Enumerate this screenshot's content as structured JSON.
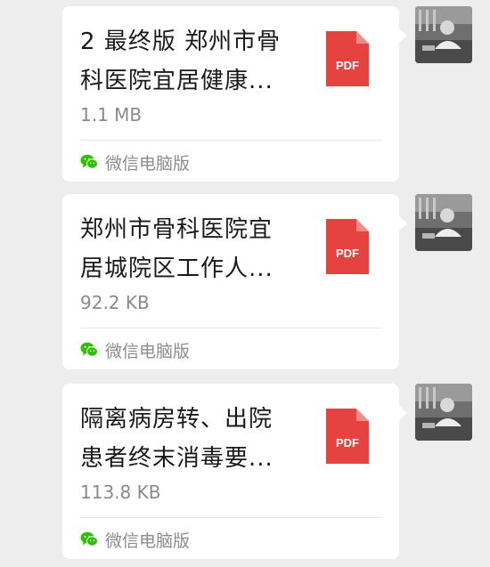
{
  "messages": [
    {
      "file_name_lines": [
        "2 最终版  郑州市骨",
        "科医院宜居健康..."
      ],
      "file_size": "1.1 MB",
      "file_type": "PDF",
      "source_label": "微信电脑版"
    },
    {
      "file_name_lines": [
        "郑州市骨科医院宜",
        "居城院区工作人..."
      ],
      "file_size": "92.2 KB",
      "file_type": "PDF",
      "source_label": "微信电脑版"
    },
    {
      "file_name_lines": [
        "隔离病房转、出院",
        "患者终末消毒要..."
      ],
      "file_size": "113.8 KB",
      "file_type": "PDF",
      "source_label": "微信电脑版"
    }
  ],
  "colors": {
    "background": "#ededed",
    "bubble": "#ffffff",
    "pdf_icon": "#e64340",
    "wechat_green": "#2dc100"
  },
  "icons": {
    "file": "pdf-file-icon",
    "source": "wechat-icon",
    "sender": "avatar"
  }
}
